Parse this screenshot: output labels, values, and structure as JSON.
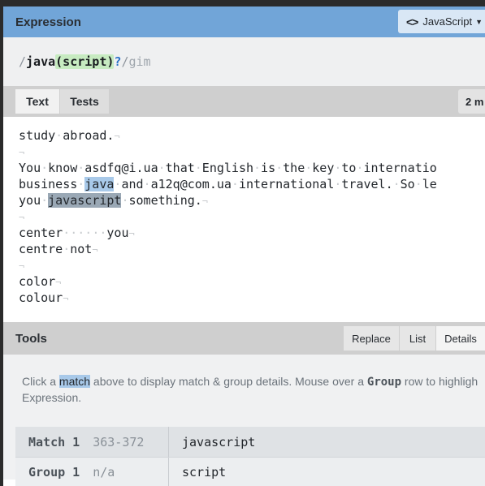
{
  "expression_panel": {
    "title": "Expression",
    "flavor_label": "JavaScript",
    "flavor_icon": "code-brackets-icon",
    "regex": {
      "open_slash": "/",
      "literal": "java",
      "group": "(script)",
      "quantifier": "?",
      "close_slash": "/",
      "flags": "gim"
    }
  },
  "text_panel": {
    "tabs": [
      {
        "label": "Text",
        "active": true
      },
      {
        "label": "Tests",
        "active": false
      }
    ],
    "match_count": "2 m",
    "lines": [
      "study abroad.",
      "",
      "You know asdfq@i.ua that English is the key to internatio",
      "business java and a12q@com.ua international travel. So le",
      "you javascript something.",
      "",
      "center      you",
      "centre not",
      "",
      "color",
      "colour"
    ]
  },
  "tools_panel": {
    "title": "Tools",
    "tabs": [
      {
        "label": "Replace",
        "active": false
      },
      {
        "label": "List",
        "active": false
      },
      {
        "label": "Details",
        "active": true
      }
    ],
    "help_text": {
      "prefix": "Click a ",
      "match_word": "match",
      "middle": " above to display match & group details. Mouse over a ",
      "group_word": "Group",
      "suffix": " row to highligh",
      "line2": "Expression."
    },
    "details": [
      {
        "label": "Match 1",
        "sub": "363-372",
        "value": "javascript"
      },
      {
        "label": "Group 1",
        "sub": "n/a",
        "value": "script"
      }
    ]
  },
  "colors": {
    "header_blue": "#71a5d8",
    "match_highlight": "#a8c9e9",
    "selected_match": "#9aa8b5",
    "group_green": "#c7ebc1",
    "quantifier_blue": "#2d74c8"
  }
}
